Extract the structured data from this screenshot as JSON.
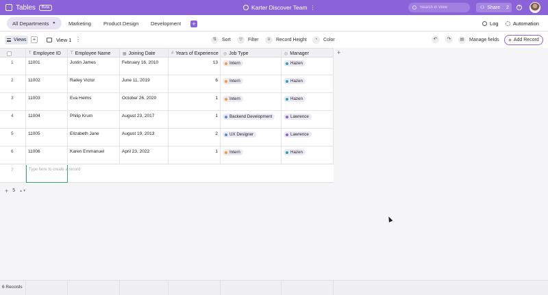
{
  "app": {
    "name": "Tables",
    "badge": "Beta",
    "team": "Karter Discover Team",
    "team_menu": "⋮"
  },
  "search": {
    "placeholder": "Search in View"
  },
  "share": {
    "label": "Share",
    "count": "2"
  },
  "departments": {
    "tabs": [
      {
        "label": "All Departments",
        "active": true
      },
      {
        "label": "Marketing"
      },
      {
        "label": "Product Design"
      },
      {
        "label": "Development"
      }
    ],
    "add_label": "+",
    "log_label": "Log",
    "automation_label": "Automation"
  },
  "toolbar": {
    "views_label": "Views",
    "add_view_label": "+",
    "view_name": "View 1",
    "view_more": "⋮",
    "sort_label": "Sort",
    "filter_label": "Filter",
    "record_height_label": "Record Height",
    "color_label": "Color",
    "manage_fields_label": "Manage fields",
    "add_record_label": "Add Record"
  },
  "table": {
    "columns": [
      {
        "label": "Employee ID",
        "icon": "text-icon"
      },
      {
        "label": "Employee Name",
        "icon": "text-icon"
      },
      {
        "label": "Joining Date",
        "icon": "date-icon"
      },
      {
        "label": "Years of Experience",
        "icon": "number-icon"
      },
      {
        "label": "Job Type",
        "icon": "select-icon"
      },
      {
        "label": "Manager",
        "icon": "select-icon"
      }
    ],
    "rows": [
      {
        "idx": "1",
        "id": "11001",
        "name": "Justin James",
        "date": "February 16, 2010",
        "years": "13",
        "job": "Intern",
        "job_color": "#f0a030",
        "manager": "Hazen",
        "manager_color": "#1fa8c8"
      },
      {
        "idx": "2",
        "id": "11002",
        "name": "Railey Victor",
        "date": "June 11, 2019",
        "years": "6",
        "job": "Intern",
        "job_color": "#f0a030",
        "manager": "Hazen",
        "manager_color": "#1fa8c8"
      },
      {
        "idx": "3",
        "id": "11003",
        "name": "Eva Helms",
        "date": "October 26, 2020",
        "years": "1",
        "job": "Intern",
        "job_color": "#f0a030",
        "manager": "Hazen",
        "manager_color": "#1fa8c8"
      },
      {
        "idx": "4",
        "id": "11004",
        "name": "Philip Krum",
        "date": "August 23, 2017",
        "years": "1",
        "job": "Backend Development",
        "job_color": "#4a90e2",
        "manager": "Lawrence",
        "manager_color": "#8b63d9"
      },
      {
        "idx": "5",
        "id": "11005",
        "name": "Elizabeth Jane",
        "date": "August 19, 2013",
        "years": "2",
        "job": "UX Designer",
        "job_color": "#4a90e2",
        "manager": "Lawrence",
        "manager_color": "#8b63d9"
      },
      {
        "idx": "6",
        "id": "11006",
        "name": "Karen Emmanuel",
        "date": "April 23, 2022",
        "years": "1",
        "job": "Intern",
        "job_color": "#f0a030",
        "manager": "Hazen",
        "manager_color": "#1fa8c8"
      }
    ],
    "new_row": {
      "idx": "7",
      "placeholder": "Type here to create a record"
    },
    "add_field_label": "+",
    "footer": {
      "add": "+",
      "count": "5",
      "arrows": "▲▼"
    },
    "records_count": "6 Records"
  },
  "colors": {
    "accent": "#8b63d9",
    "select_pill_bg": "#ece9f5"
  }
}
